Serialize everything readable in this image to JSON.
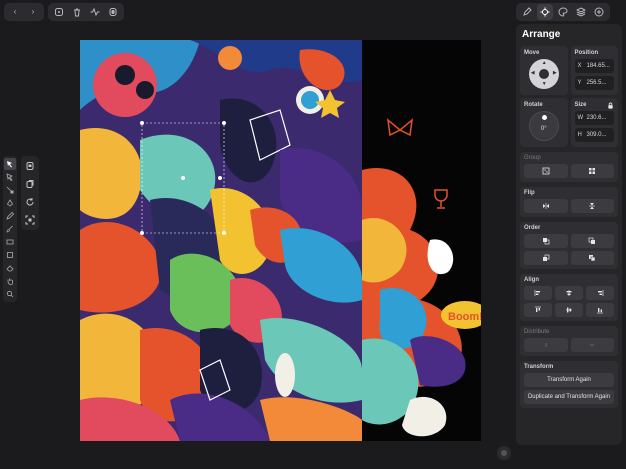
{
  "toolbar": {
    "left_group": [
      {
        "name": "menu-icon",
        "glyph": "‹"
      },
      {
        "name": "chevron-right-icon",
        "glyph": "›"
      }
    ],
    "edit_group": [
      {
        "name": "duplicate-icon"
      },
      {
        "name": "trash-icon"
      },
      {
        "name": "pulse-icon"
      },
      {
        "name": "mask-icon"
      }
    ],
    "right_group": [
      {
        "name": "pen-icon"
      },
      {
        "name": "arrange-icon",
        "active": true
      },
      {
        "name": "style-icon"
      },
      {
        "name": "layers-icon"
      },
      {
        "name": "add-icon"
      }
    ]
  },
  "tools": [
    {
      "name": "select-tool",
      "active": true
    },
    {
      "name": "direct-select-tool"
    },
    {
      "name": "node-tool"
    },
    {
      "name": "pen-tool"
    },
    {
      "name": "pencil-tool"
    },
    {
      "name": "brush-tool"
    },
    {
      "name": "text-tool"
    },
    {
      "name": "shape-tool"
    },
    {
      "name": "eraser-tool"
    },
    {
      "name": "hand-tool"
    },
    {
      "name": "zoom-tool"
    }
  ],
  "tools2": [
    {
      "name": "lock-tool"
    },
    {
      "name": "copy-tool"
    },
    {
      "name": "rotate-tool"
    },
    {
      "name": "fit-tool"
    }
  ],
  "panel": {
    "title": "Arrange",
    "move_label": "Move",
    "position_label": "Position",
    "x_key": "X",
    "x_value": "184.65...",
    "y_key": "Y",
    "y_value": "256.5...",
    "rotate_label": "Rotate",
    "rotate_value": "0°",
    "size_label": "Size",
    "w_key": "W",
    "w_value": "230.6...",
    "h_key": "H",
    "h_value": "309.0...",
    "group_label": "Group",
    "flip_label": "Flip",
    "order_label": "Order",
    "align_label": "Align",
    "distribute_label": "Distribute",
    "transform_label": "Transform",
    "transform_again": "Transform Again",
    "duplicate_transform": "Duplicate and Transform Again"
  },
  "artwork": {
    "boom_text": "Boom!"
  },
  "colors": {
    "background": "#1b1b1d",
    "panel": "#262629",
    "artboard": "#3b2a6e"
  }
}
